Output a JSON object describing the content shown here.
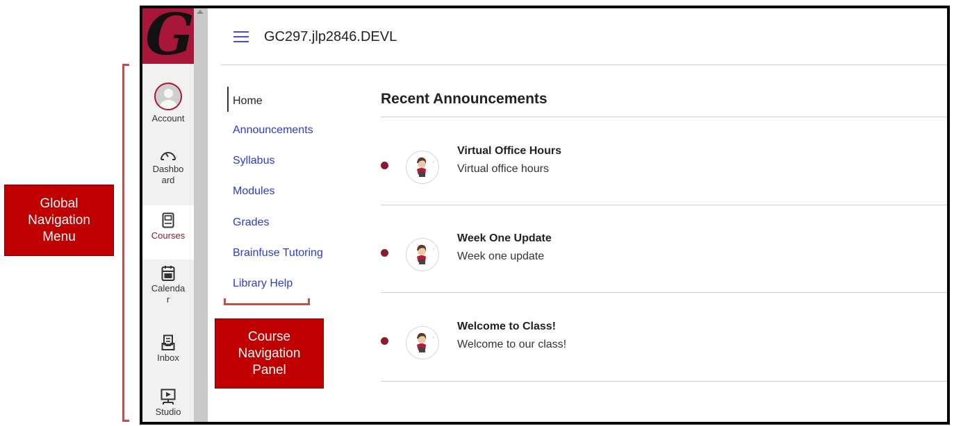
{
  "annotations": {
    "global_label": [
      "Global",
      "Navigation",
      "Menu"
    ],
    "course_label": [
      "Course",
      "Navigation",
      "Panel"
    ],
    "accent_color": "#c00000"
  },
  "global_nav": {
    "logo_letter": "G",
    "items": [
      {
        "label": "Account",
        "icon": "account-avatar-icon"
      },
      {
        "label_lines": [
          "Dashbo",
          "ard"
        ],
        "icon": "dashboard-gauge-icon"
      },
      {
        "label": "Courses",
        "icon": "courses-book-icon",
        "active": true
      },
      {
        "label_lines": [
          "Calenda",
          "r"
        ],
        "icon": "calendar-icon"
      },
      {
        "label": "Inbox",
        "icon": "inbox-icon"
      },
      {
        "label": "Studio",
        "icon": "studio-icon"
      }
    ]
  },
  "header": {
    "course_title": "GC297.jlp2846.DEVL"
  },
  "course_nav": {
    "items": [
      {
        "label": "Home",
        "active": true
      },
      {
        "label": "Announcements"
      },
      {
        "label": "Syllabus"
      },
      {
        "label": "Modules"
      },
      {
        "label": "Grades"
      },
      {
        "label": "Brainfuse Tutoring"
      },
      {
        "label": "Library Help"
      }
    ]
  },
  "announcements": {
    "heading": "Recent Announcements",
    "items": [
      {
        "title": "Virtual Office Hours",
        "body": "Virtual office hours"
      },
      {
        "title": "Week One Update",
        "body": "Week one update"
      },
      {
        "title": "Welcome to Class!",
        "body": "Welcome to our class!"
      }
    ]
  }
}
